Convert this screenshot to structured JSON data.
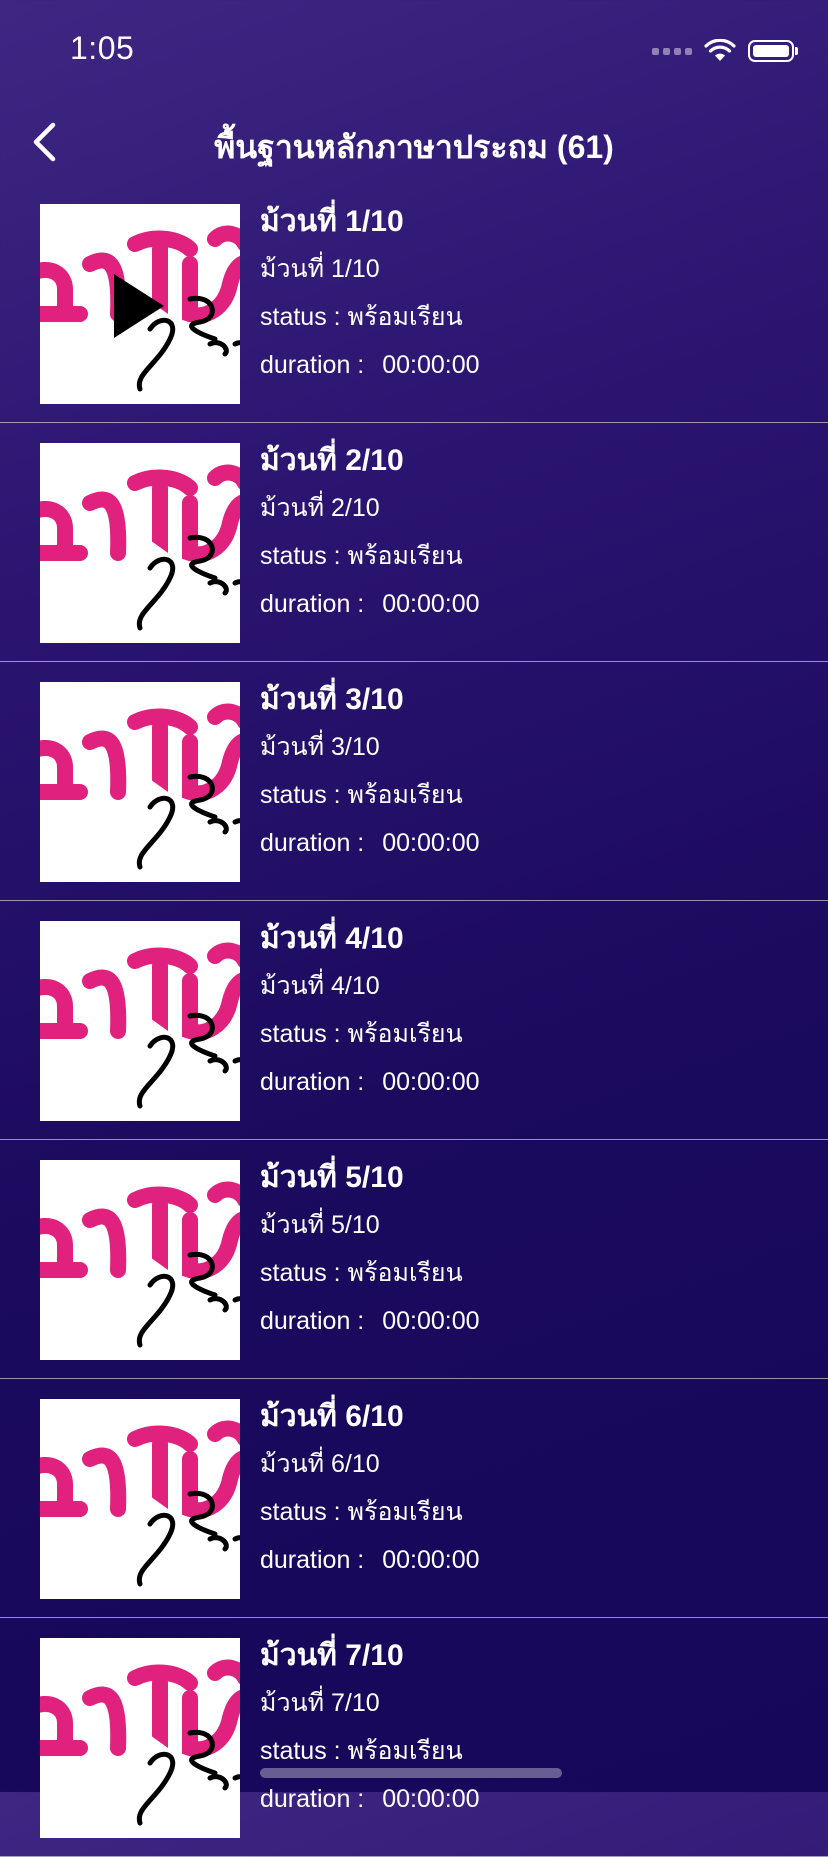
{
  "status_bar": {
    "time": "1:05"
  },
  "header": {
    "title": "พื้นฐานหลักภาษาประถม (61)"
  },
  "labels": {
    "status_label": "status :",
    "duration_label": "duration :"
  },
  "colors": {
    "accent_pink": "#e0217d",
    "background_top": "#3f2683",
    "background_bottom": "#16075a"
  },
  "episodes": [
    {
      "title": "ม้วนที่ 1/10",
      "subtitle": "ม้วนที่ 1/10",
      "status": "พร้อมเรียน",
      "duration": "00:00:00"
    },
    {
      "title": "ม้วนที่ 2/10",
      "subtitle": "ม้วนที่ 2/10",
      "status": "พร้อมเรียน",
      "duration": "00:00:00"
    },
    {
      "title": "ม้วนที่ 3/10",
      "subtitle": "ม้วนที่ 3/10",
      "status": "พร้อมเรียน",
      "duration": "00:00:00"
    },
    {
      "title": "ม้วนที่ 4/10",
      "subtitle": "ม้วนที่ 4/10",
      "status": "พร้อมเรียน",
      "duration": "00:00:00"
    },
    {
      "title": "ม้วนที่ 5/10",
      "subtitle": "ม้วนที่ 5/10",
      "status": "พร้อมเรียน",
      "duration": "00:00:00"
    },
    {
      "title": "ม้วนที่ 6/10",
      "subtitle": "ม้วนที่ 6/10",
      "status": "พร้อมเรียน",
      "duration": "00:00:00"
    },
    {
      "title": "ม้วนที่ 7/10",
      "subtitle": "ม้วนที่ 7/10",
      "status": "พร้อมเรียน",
      "duration": "00:00:00"
    }
  ]
}
